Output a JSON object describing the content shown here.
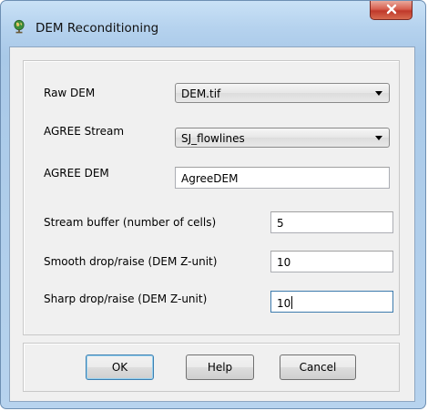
{
  "window": {
    "title": "DEM Reconditioning",
    "close_symbol": "x",
    "app_icon": "globe-icon"
  },
  "form": {
    "raw_dem": {
      "label": "Raw DEM",
      "value": "DEM.tif"
    },
    "agree_stream": {
      "label": "AGREE Stream",
      "value": "SJ_flowlines"
    },
    "agree_dem": {
      "label": "AGREE DEM",
      "value": "AgreeDEM"
    },
    "stream_buffer": {
      "label": "Stream buffer (number of cells)",
      "value": "5"
    },
    "smooth_drop": {
      "label": "Smooth drop/raise (DEM Z-unit)",
      "value": "10"
    },
    "sharp_drop": {
      "label": "Sharp drop/raise (DEM Z-unit)",
      "value": "10"
    }
  },
  "buttons": {
    "ok": "OK",
    "help": "Help",
    "cancel": "Cancel"
  }
}
